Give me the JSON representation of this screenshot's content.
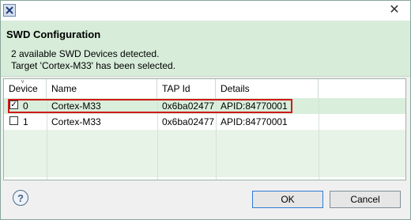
{
  "window": {
    "title_icon": "app-x-icon",
    "close_glyph": "✕"
  },
  "header": {
    "title": "SWD Configuration",
    "line1": "2 available SWD Devices detected.",
    "line2": "Target 'Cortex-M33' has been selected."
  },
  "table": {
    "columns": [
      "Device",
      "Name",
      "TAP Id",
      "Details"
    ],
    "rows": [
      {
        "checked": "✓",
        "device": "0",
        "name": "Cortex-M33",
        "tap": "0x6ba02477",
        "details": "APID:84770001",
        "selected": true
      },
      {
        "checked": "",
        "device": "1",
        "name": "Cortex-M33",
        "tap": "0x6ba02477",
        "details": "APID:84770001",
        "selected": false
      }
    ],
    "highlight_color": "#d01919"
  },
  "footer": {
    "help_glyph": "?",
    "ok_label": "OK",
    "cancel_label": "Cancel"
  },
  "colors": {
    "header_bg": "#d7ecd9",
    "selected_row_bg": "#d9eedb"
  }
}
